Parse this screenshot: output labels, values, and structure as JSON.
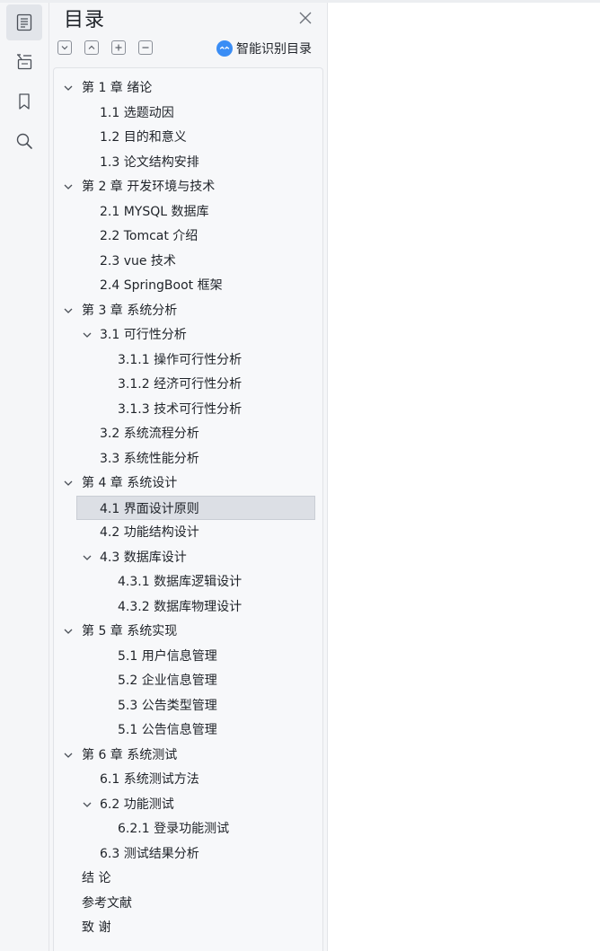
{
  "panel": {
    "title": "目录",
    "ai_button_label": "智能识别目录"
  },
  "rail": {
    "items": [
      {
        "icon": "outline-icon",
        "active": true
      },
      {
        "icon": "thumbnail-icon",
        "active": false
      },
      {
        "icon": "bookmark-icon",
        "active": false
      },
      {
        "icon": "search-icon",
        "active": false
      }
    ]
  },
  "toolbar": {
    "buttons": [
      "collapse-all-icon",
      "expand-up-icon",
      "add-entry-icon",
      "remove-entry-icon"
    ]
  },
  "toc": {
    "items": [
      {
        "label": "第 1 章  绪论",
        "level": 0,
        "expanded": true
      },
      {
        "label": "1.1 选题动因",
        "level": 1
      },
      {
        "label": "1.2 目的和意义",
        "level": 1
      },
      {
        "label": "1.3 论文结构安排",
        "level": 1
      },
      {
        "label": "第 2 章  开发环境与技术",
        "level": 0,
        "expanded": true
      },
      {
        "label": "2.1 MYSQL 数据库",
        "level": 1
      },
      {
        "label": "2.2 Tomcat  介绍",
        "level": 1
      },
      {
        "label": "2.3 vue 技术",
        "level": 1
      },
      {
        "label": "2.4 SpringBoot 框架",
        "level": 1
      },
      {
        "label": "第 3 章  系统分析",
        "level": 0,
        "expanded": true
      },
      {
        "label": "3.1 可行性分析",
        "level": 1,
        "expanded": true
      },
      {
        "label": "3.1.1 操作可行性分析",
        "level": 2
      },
      {
        "label": "3.1.2 经济可行性分析",
        "level": 2
      },
      {
        "label": "3.1.3 技术可行性分析",
        "level": 2
      },
      {
        "label": "3.2 系统流程分析",
        "level": 1
      },
      {
        "label": "3.3 系统性能分析",
        "level": 1
      },
      {
        "label": "第 4 章  系统设计",
        "level": 0,
        "expanded": true
      },
      {
        "label": "4.1 界面设计原则",
        "level": 1,
        "selected": true
      },
      {
        "label": "4.2 功能结构设计",
        "level": 1
      },
      {
        "label": "4.3 数据库设计",
        "level": 1,
        "expanded": true
      },
      {
        "label": "4.3.1  数据库逻辑设计",
        "level": 2
      },
      {
        "label": "4.3.2  数据库物理设计",
        "level": 2
      },
      {
        "label": "第 5 章  系统实现",
        "level": 0,
        "expanded": true
      },
      {
        "label": "5.1 用户信息管理",
        "level": 2
      },
      {
        "label": "5.2  企业信息管理",
        "level": 2
      },
      {
        "label": "5.3 公告类型管理",
        "level": 2
      },
      {
        "label": "5.1 公告信息管理",
        "level": 2
      },
      {
        "label": "第 6 章  系统测试",
        "level": 0,
        "expanded": true
      },
      {
        "label": "6.1  系统测试方法",
        "level": 1
      },
      {
        "label": "6.2  功能测试",
        "level": 1,
        "expanded": true
      },
      {
        "label": "6.2.1  登录功能测试",
        "level": 2
      },
      {
        "label": "6.3  测试结果分析",
        "level": 1
      },
      {
        "label": "结    论",
        "level": 0
      },
      {
        "label": "参考文献",
        "level": 0
      },
      {
        "label": "致    谢",
        "level": 0
      }
    ]
  }
}
